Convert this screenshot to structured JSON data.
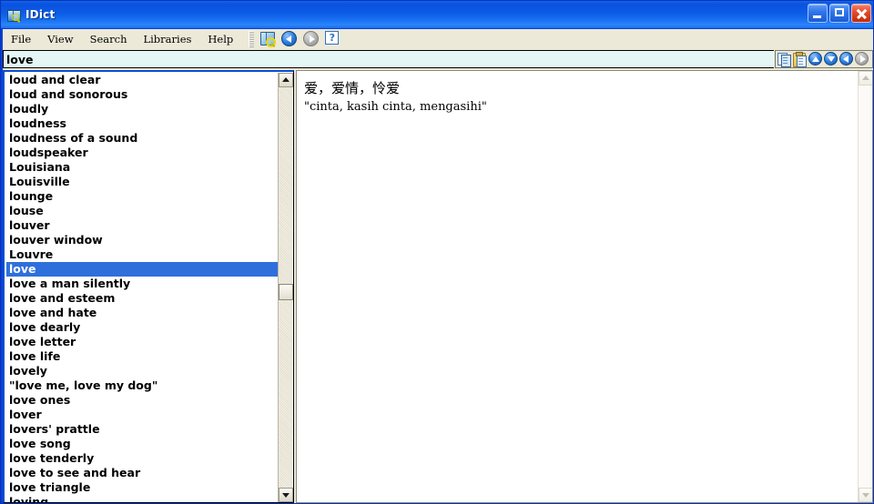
{
  "window": {
    "title": "IDict",
    "app_icon": "dictionary-book-icon",
    "controls": {
      "minimize": "minimize-button",
      "maximize": "maximize-button",
      "close": "close-button"
    },
    "colors": {
      "titlebar_blue": "#0a52df",
      "menubar_beige": "#ece9d8",
      "selection_blue": "#2f6fdc",
      "search_field_bg": "#e4f7f4",
      "window_border": "#0a3fd8"
    }
  },
  "menubar": {
    "items": [
      {
        "label": "File"
      },
      {
        "label": "View"
      },
      {
        "label": "Search"
      },
      {
        "label": "Libraries"
      },
      {
        "label": "Help"
      }
    ],
    "toolbar": [
      {
        "name": "dictionary-lookup-icon",
        "enabled": true
      },
      {
        "name": "back-arrow-icon",
        "enabled": true
      },
      {
        "name": "forward-arrow-icon",
        "enabled": false
      },
      {
        "name": "help-question-icon",
        "enabled": true,
        "glyph": "?"
      }
    ]
  },
  "search": {
    "value": "love",
    "placeholder": "",
    "tools": [
      {
        "name": "copy-icon",
        "enabled": true
      },
      {
        "name": "paste-icon",
        "enabled": true
      },
      {
        "name": "scroll-up-icon",
        "enabled": true
      },
      {
        "name": "scroll-down-icon",
        "enabled": true
      },
      {
        "name": "previous-entry-icon",
        "enabled": true
      },
      {
        "name": "next-entry-icon",
        "enabled": false
      }
    ]
  },
  "wordlist": {
    "selected": "love",
    "items": [
      "loud and clear",
      "loud and sonorous",
      "loudly",
      "loudness",
      "loudness of a sound",
      "loudspeaker",
      "Louisiana",
      "Louisville",
      "lounge",
      "louse",
      "louver",
      "louver window",
      "Louvre",
      "love",
      "love a man silently",
      "love and esteem",
      "love and hate",
      "love dearly",
      "love letter",
      "love life",
      "lovely",
      "\"love me, love my dog\"",
      "love ones",
      "lover",
      "lovers' prattle",
      "love song",
      "love tenderly",
      "love to see and hear",
      "love triangle",
      "loving"
    ]
  },
  "definition": {
    "headword": "love",
    "chinese": "爱，爱情，怜爱",
    "indonesian": "\"cinta, kasih cinta, mengasihi\""
  }
}
